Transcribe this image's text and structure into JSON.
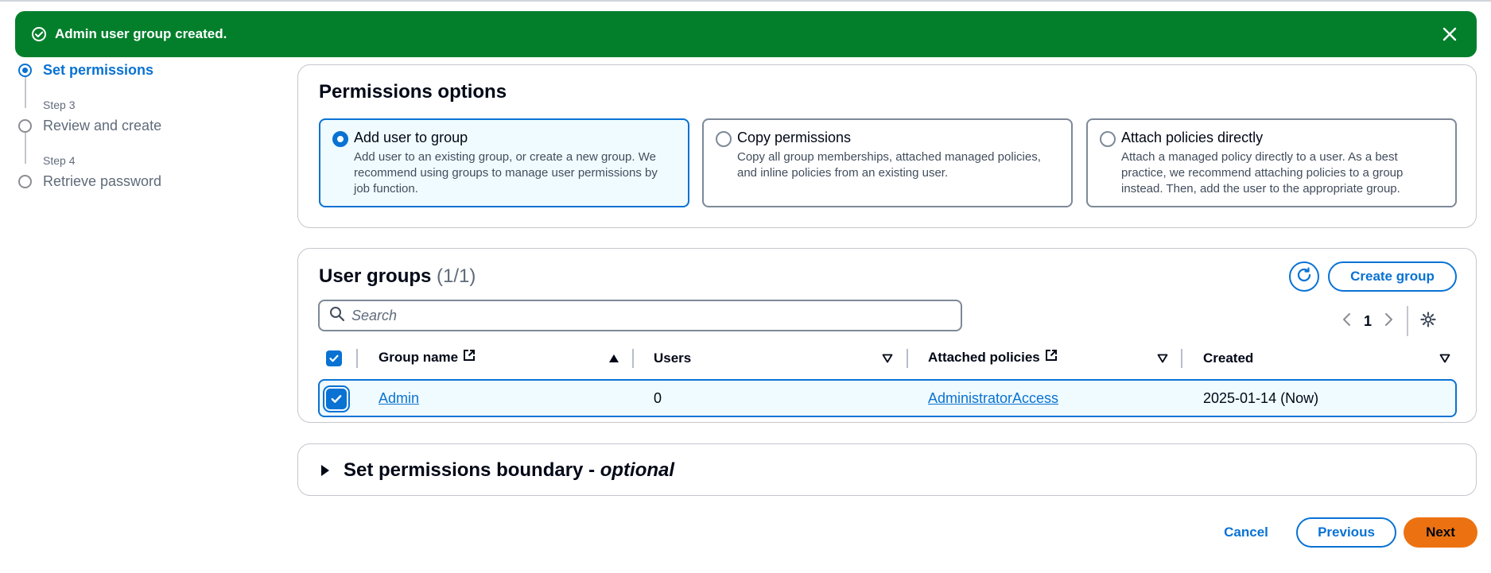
{
  "flash": {
    "message": "Admin user group created.",
    "icon": "check-circle-icon",
    "close_icon": "close-icon",
    "color": "#037f2c"
  },
  "stepper": {
    "current": "Set permissions",
    "steps": [
      {
        "number": "Step 3",
        "label": "Review and create"
      },
      {
        "number": "Step 4",
        "label": "Retrieve password"
      }
    ]
  },
  "permissions_options": {
    "title": "Permissions options",
    "options": [
      {
        "title": "Add user to group",
        "description": "Add user to an existing group, or create a new group. We recommend using groups to manage user permissions by job function.",
        "selected": true
      },
      {
        "title": "Copy permissions",
        "description": "Copy all group memberships, attached managed policies, and inline policies from an existing user.",
        "selected": false
      },
      {
        "title": "Attach policies directly",
        "description": "Attach a managed policy directly to a user. As a best practice, we recommend attaching policies to a group instead. Then, add the user to the appropriate group.",
        "selected": false
      }
    ]
  },
  "user_groups": {
    "title": "User groups",
    "count": "(1/1)",
    "create_label": "Create group",
    "search_placeholder": "Search",
    "page": "1",
    "columns": [
      "Group name",
      "Users",
      "Attached policies",
      "Created"
    ],
    "rows": [
      {
        "group_name": "Admin",
        "users": "0",
        "attached_policies": "AdministratorAccess",
        "created": "2025-01-14 (Now)",
        "checked": true
      }
    ]
  },
  "boundary": {
    "title": "Set permissions boundary - ",
    "optional": "optional"
  },
  "footer": {
    "cancel": "Cancel",
    "previous": "Previous",
    "next": "Next",
    "primary_color": "#ec7211"
  }
}
